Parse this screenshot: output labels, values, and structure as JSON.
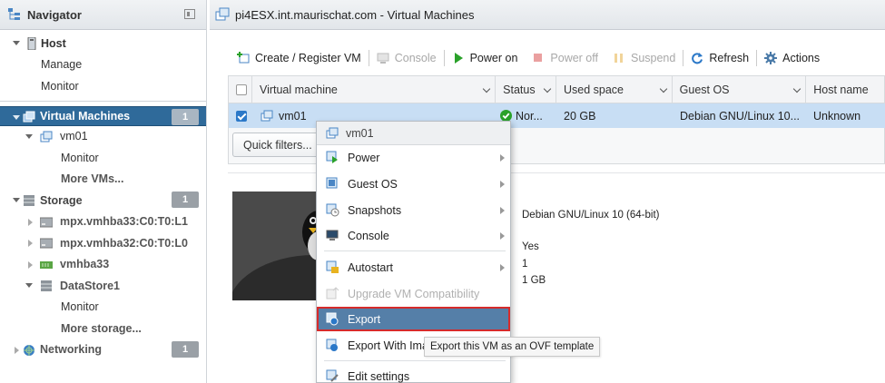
{
  "navigator": {
    "title": "Navigator",
    "items": [
      {
        "label": "Host"
      },
      {
        "label": "Manage"
      },
      {
        "label": "Monitor"
      },
      {
        "label": "Virtual Machines",
        "badge": "1"
      },
      {
        "label": "vm01"
      },
      {
        "label": "Monitor"
      },
      {
        "label": "More VMs..."
      },
      {
        "label": "Storage",
        "badge": "1"
      },
      {
        "label": "mpx.vmhba33:C0:T0:L1"
      },
      {
        "label": "mpx.vmhba32:C0:T0:L0"
      },
      {
        "label": "vmhba33"
      },
      {
        "label": "DataStore1"
      },
      {
        "label": "Monitor"
      },
      {
        "label": "More storage..."
      },
      {
        "label": "Networking",
        "badge": "1"
      }
    ]
  },
  "main": {
    "title": "pi4ESX.int.maurischat.com - Virtual Machines"
  },
  "toolbar": {
    "create": "Create / Register VM",
    "console": "Console",
    "power_on": "Power on",
    "power_off": "Power off",
    "suspend": "Suspend",
    "refresh": "Refresh",
    "actions": "Actions"
  },
  "grid": {
    "columns": [
      "Virtual machine",
      "Status",
      "Used space",
      "Guest OS",
      "Host name"
    ],
    "rows": [
      {
        "name": "vm01",
        "status": "Nor...",
        "used": "20 GB",
        "guest": "Debian GNU/Linux 10...",
        "host": "Unknown"
      }
    ],
    "quick_filters": "Quick filters..."
  },
  "details": {
    "guest_os": "Debian GNU/Linux 10 (64-bit)",
    "v1": "Yes",
    "v2": "1",
    "v3": "1 GB"
  },
  "context_menu": {
    "header": "vm01",
    "items": [
      {
        "label": "Power",
        "submenu": true
      },
      {
        "label": "Guest OS",
        "submenu": true
      },
      {
        "label": "Snapshots",
        "submenu": true
      },
      {
        "label": "Console",
        "submenu": true
      },
      {
        "label": "Autostart",
        "submenu": true
      },
      {
        "label": "Upgrade VM Compatibility",
        "disabled": true
      },
      {
        "label": "Export",
        "highlighted": true
      },
      {
        "label": "Export With Images"
      },
      {
        "label": "Edit settings"
      }
    ]
  },
  "tooltip": "Export this VM as an OVF template",
  "colors": {
    "selection": "#2f6a9a",
    "row_selected": "#c8def4",
    "menu_highlight": "#557fa8",
    "highlight_border": "#d62b2b",
    "status_ok": "#2aa12a"
  }
}
